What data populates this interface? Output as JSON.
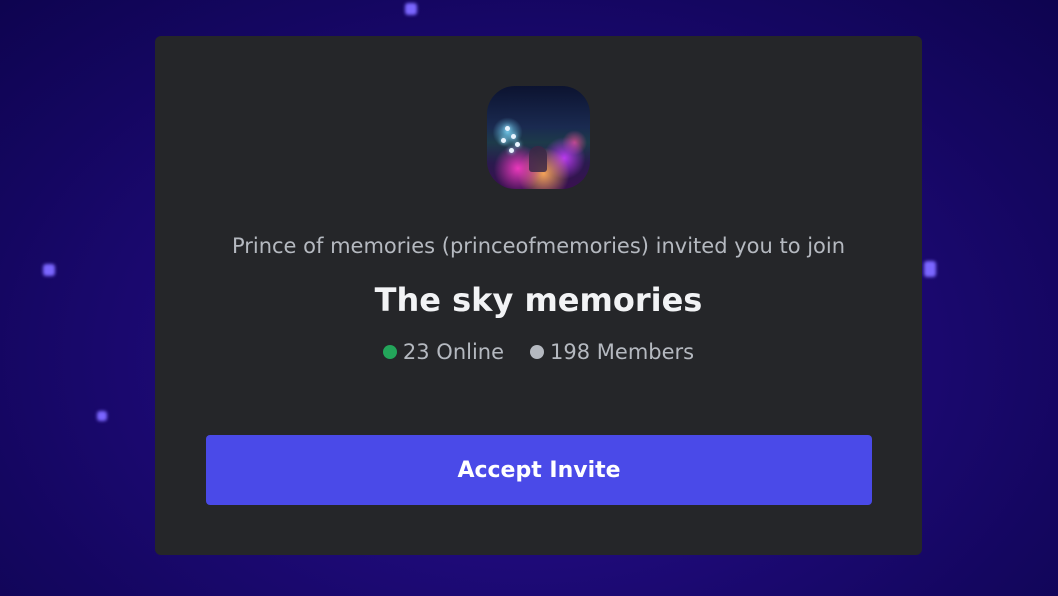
{
  "invite": {
    "inviter_text": "Prince of memories (princeofmemories) invited you to join",
    "server_name": "The sky memories",
    "online_text": "23 Online",
    "members_text": "198 Members",
    "accept_label": "Accept Invite"
  },
  "colors": {
    "background": "#1e0a78",
    "card": "#252629",
    "button": "#4a4ae8",
    "online_dot": "#23a55a",
    "members_dot": "#b5b9c0"
  }
}
